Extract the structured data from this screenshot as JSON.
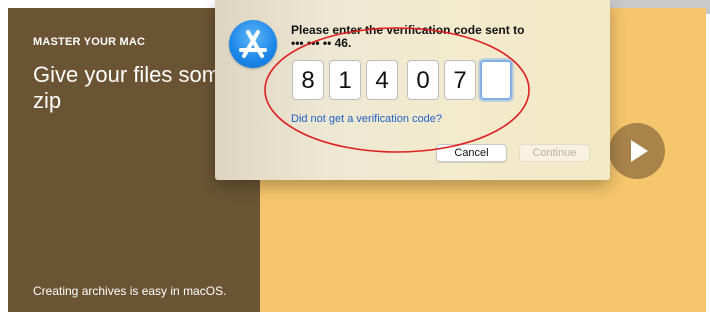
{
  "promo": {
    "eyebrow": "MASTER YOUR MAC",
    "headline": "Give your files some zip",
    "caption": "Creating archives is easy in macOS."
  },
  "dialog": {
    "prompt_line1": "Please enter the verification code sent to",
    "prompt_line2": "••• ••• •• 46.",
    "digits": [
      "8",
      "1",
      "4",
      "0",
      "7",
      ""
    ],
    "link": "Did not get a verification code?",
    "cancel_label": "Cancel",
    "continue_label": "Continue",
    "app_icon": "app-store-icon"
  },
  "media": {
    "icon": "play-icon"
  },
  "colors": {
    "promo_left": "#6b5434",
    "promo_right": "#f6c66c",
    "link": "#1d62c6",
    "annotation": "#e02020"
  }
}
